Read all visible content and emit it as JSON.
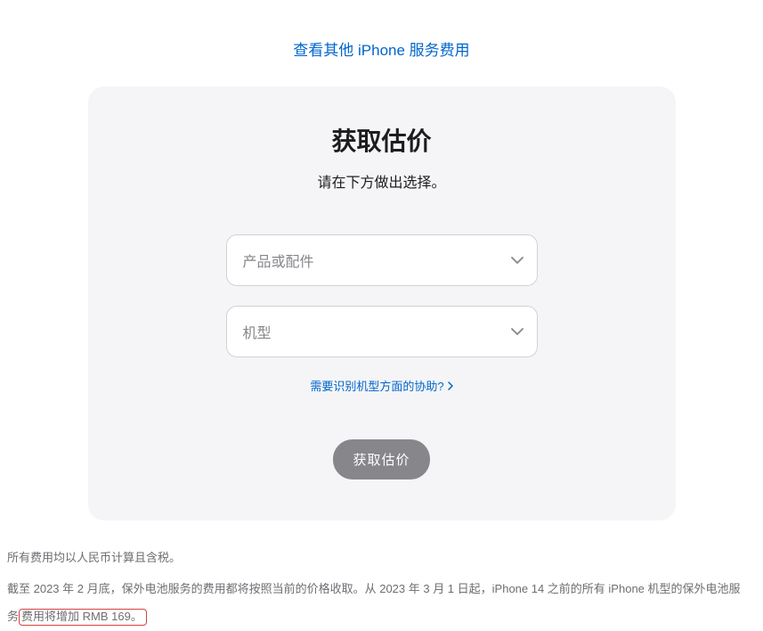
{
  "top_link": "查看其他 iPhone 服务费用",
  "panel": {
    "title": "获取估价",
    "subtitle": "请在下方做出选择。",
    "select_product_placeholder": "产品或配件",
    "select_model_placeholder": "机型",
    "help_link": "需要识别机型方面的协助?",
    "button_label": "获取估价"
  },
  "footer": {
    "line1": "所有费用均以人民币计算且含税。",
    "line2_part1": "截至 2023 年 2 月底，保外电池服务的费用都将按照当前的价格收取。从 2023 年 3 月 1 日起，iPhone 14 之前的所有 iPhone 机型的保外电池服",
    "line2_part2_prefix": "务",
    "line2_highlight": "费用将增加 RMB 169。"
  }
}
